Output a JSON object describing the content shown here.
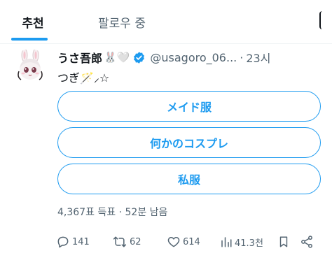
{
  "tabs": [
    {
      "label": "추천",
      "active": true
    },
    {
      "label": "팔로우 중",
      "active": false
    }
  ],
  "tweet": {
    "author_name": "うさ吾郎",
    "name_emojis": "🐰🤍",
    "handle": "@usagoro_06...",
    "separator": "·",
    "time": "23시",
    "text": "つぎ🪄⸝☆",
    "verified": true
  },
  "poll": {
    "options": [
      "メイド服",
      "何かのコスプレ",
      "私服"
    ],
    "meta": "4,367표 득표 · 52분 남음"
  },
  "actions": {
    "replies": "141",
    "reposts": "62",
    "likes": "614",
    "views": "41.3천"
  },
  "colors": {
    "accent": "#1d9bf0",
    "text": "#0f1419",
    "muted": "#536471"
  },
  "icons": [
    "verified-badge-icon",
    "reply-icon",
    "repost-icon",
    "like-icon",
    "views-icon",
    "bookmark-icon",
    "share-icon"
  ]
}
